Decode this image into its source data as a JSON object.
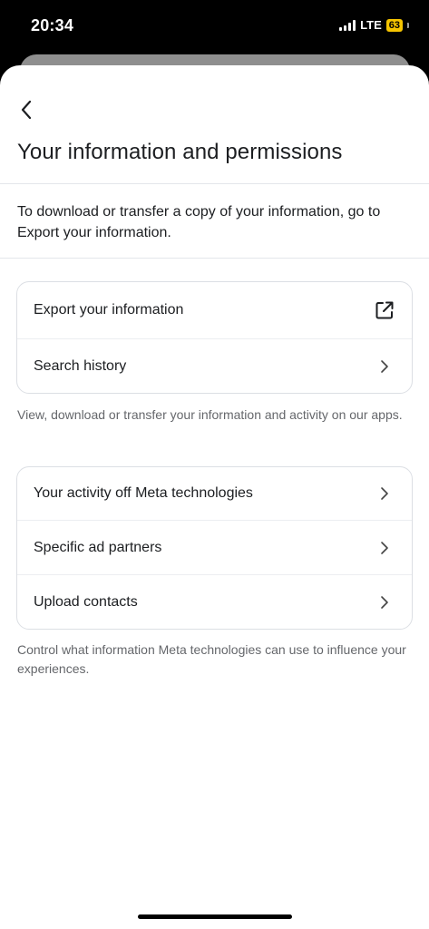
{
  "status_bar": {
    "time": "20:34",
    "network": "LTE",
    "battery": "63"
  },
  "header": {
    "back_icon": "chevron-left-icon",
    "title": "Your information and permissions"
  },
  "intro": {
    "text": "To download or transfer a copy of your information, go to Export your information."
  },
  "section_1": {
    "items": [
      {
        "label": "Export your information",
        "icon": "external-link-icon"
      },
      {
        "label": "Search history",
        "icon": "chevron-right-icon"
      }
    ],
    "caption": "View, download or transfer your information and activity on our apps."
  },
  "section_2": {
    "items": [
      {
        "label": "Your activity off Meta technologies",
        "icon": "chevron-right-icon"
      },
      {
        "label": "Specific ad partners",
        "icon": "chevron-right-icon"
      },
      {
        "label": "Upload contacts",
        "icon": "chevron-right-icon"
      }
    ],
    "caption": "Control what information Meta technologies can use to influence your experiences."
  },
  "colors": {
    "text_primary": "#1c1e21",
    "text_secondary": "#65676b",
    "battery": "#f5c400",
    "card_border": "#dcdfe4"
  }
}
